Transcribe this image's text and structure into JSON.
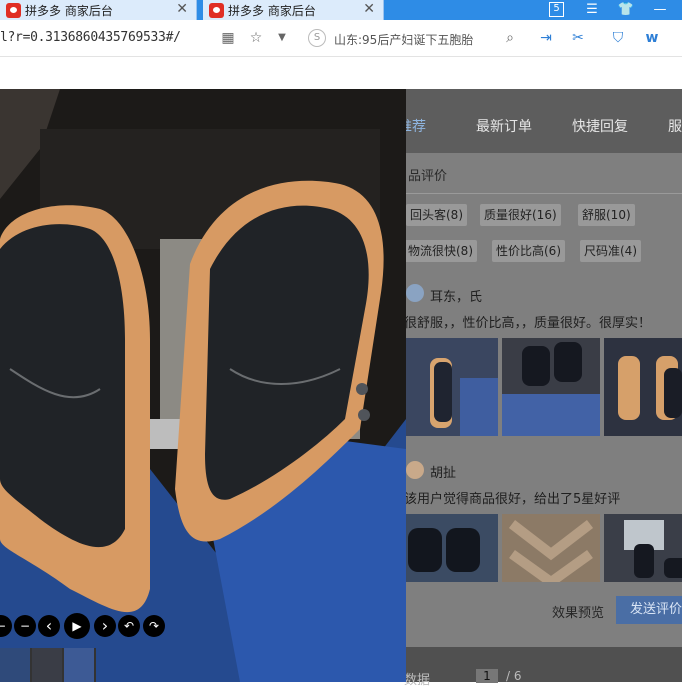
{
  "browser": {
    "tabs": [
      {
        "title": "拼多多 商家后台"
      },
      {
        "title": "拼多多 商家后台"
      }
    ],
    "tab_close": "✕",
    "window_count": "5",
    "url": "l?r=0.3136860435769533#/",
    "news_ticker": "山东:95后产妇诞下五胞胎"
  },
  "nav": {
    "items": [
      {
        "label": "推荐",
        "active": true
      },
      {
        "label": "最新订单",
        "active": false
      },
      {
        "label": "快捷回复",
        "active": false
      },
      {
        "label": "服",
        "active": false
      }
    ]
  },
  "panel": {
    "title": "品评价",
    "tags": [
      {
        "label": "回头客(8)"
      },
      {
        "label": "质量很好(16)"
      },
      {
        "label": "舒服(10)"
      },
      {
        "label": "物流很快(8)"
      },
      {
        "label": "性价比高(6)"
      },
      {
        "label": "尺码准(4)"
      }
    ],
    "reviews": [
      {
        "user": "耳东，氏",
        "text": "很舒服，，性价比高，，质量很好。很厚实！"
      },
      {
        "user": "胡扯",
        "text": "该用户觉得商品很好，给出了5星好评"
      }
    ],
    "preview_label": "效果预览",
    "send_label": "发送评价"
  },
  "bottom": {
    "partial_text": "数据",
    "page": "1",
    "total": "/ 6"
  },
  "viewer": {
    "controls": [
      "−",
      "−",
      "‹",
      "▶",
      "›",
      "↶",
      "↷"
    ]
  },
  "colors": {
    "tab_bar": "#2e8ce6",
    "send_button": "#4a6ea5",
    "overlay": "#545454"
  }
}
